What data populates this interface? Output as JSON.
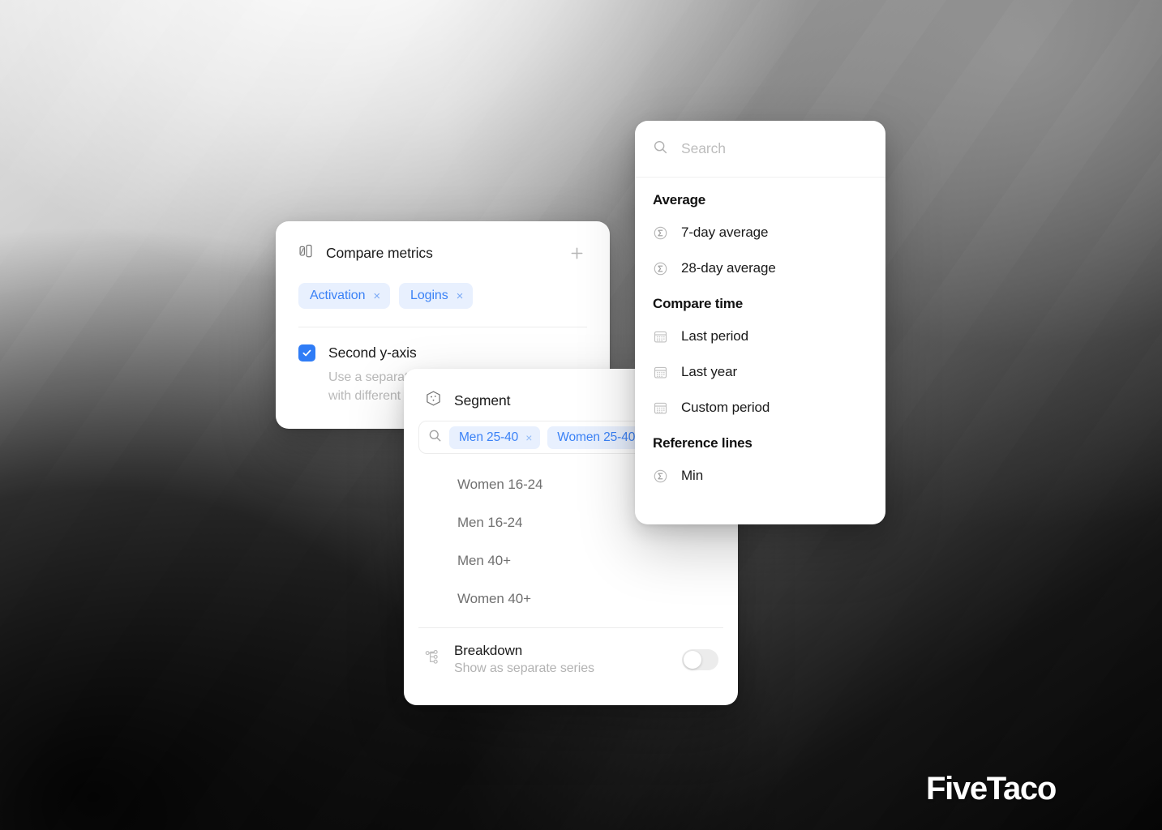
{
  "brand": {
    "name": "FiveTaco"
  },
  "compare_metrics_panel": {
    "icon": "bar-compare-icon",
    "title": "Compare metrics",
    "add_button": "add-metric-icon",
    "chips": [
      {
        "label": "Activation",
        "remove": "×"
      },
      {
        "label": "Logins",
        "remove": "×"
      }
    ],
    "second_y_axis": {
      "label": "Second y-axis",
      "checked": true,
      "description": "Use a separate scale for metrics with different ranges"
    }
  },
  "segment_panel": {
    "icon": "cube-icon",
    "title": "Segment",
    "search": {
      "icon": "search-icon",
      "chips": [
        {
          "label": "Men 25-40",
          "remove": "×"
        },
        {
          "label": "Women 25-40",
          "remove": "×"
        }
      ]
    },
    "options": [
      {
        "label": "Women 16-24"
      },
      {
        "label": "Men 16-24"
      },
      {
        "label": "Men 40+"
      },
      {
        "label": "Women 40+"
      }
    ],
    "breakdown": {
      "icon": "hierarchy-icon",
      "title": "Breakdown",
      "subtitle": "Show as separate series",
      "toggle_on": false
    }
  },
  "menu_panel": {
    "search": {
      "icon": "search-icon",
      "placeholder": "Search",
      "value": ""
    },
    "sections": [
      {
        "title": "Average",
        "items": [
          {
            "label": "7-day average",
            "icon": "sigma-circle-icon"
          },
          {
            "label": "28-day average",
            "icon": "sigma-circle-icon"
          }
        ]
      },
      {
        "title": "Compare time",
        "items": [
          {
            "label": "Last period",
            "icon": "calendar-icon"
          },
          {
            "label": "Last year",
            "icon": "calendar-icon"
          },
          {
            "label": "Custom period",
            "icon": "calendar-icon"
          }
        ]
      },
      {
        "title": "Reference lines",
        "items": [
          {
            "label": "Min",
            "icon": "sigma-circle-icon"
          }
        ]
      }
    ]
  },
  "colors": {
    "accent_blue": "#3b82f6",
    "chip_bg": "#e8f0fe",
    "checkbox_blue": "#2f7cf6",
    "muted_text": "#b9b9b9",
    "panel_bg": "#ffffff"
  }
}
